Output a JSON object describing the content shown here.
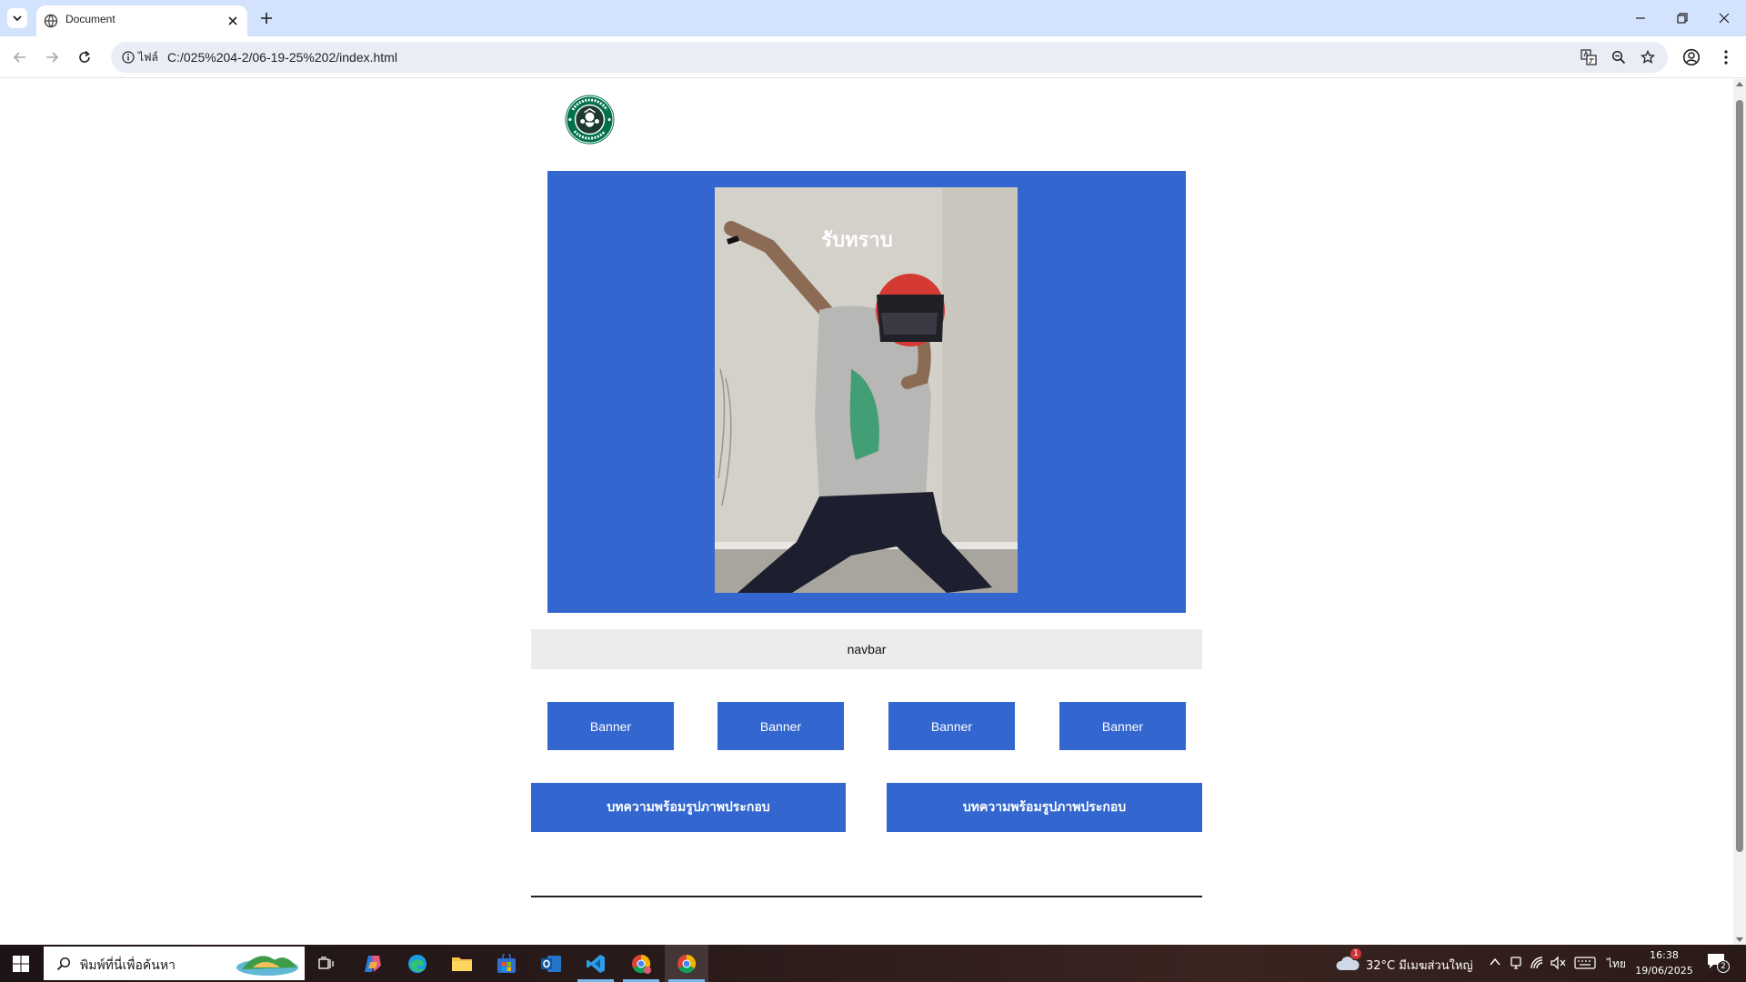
{
  "browser": {
    "tab_title": "Document",
    "site_info_label": "ไฟล์",
    "url": "C:/025%204-2/06-19-25%202/index.html"
  },
  "page": {
    "hero_caption": "รับทราบ",
    "navbar_label": "navbar",
    "banners": [
      "Banner",
      "Banner",
      "Banner",
      "Banner"
    ],
    "articles": [
      "บทความพร้อมรูปภาพประกอบ",
      "บทความพร้อมรูปภาพประกอบ"
    ],
    "colors": {
      "accent": "#3367cf",
      "navbar_bg": "#ececec"
    }
  },
  "taskbar": {
    "search_placeholder": "พิมพ์ที่นี่เพื่อค้นหา",
    "weather": "32°C  มีเมฆส่วนใหญ่",
    "weather_badge": "1",
    "language": "ไทย",
    "time": "16:38",
    "date": "19/06/2025",
    "notification_count": "2"
  }
}
